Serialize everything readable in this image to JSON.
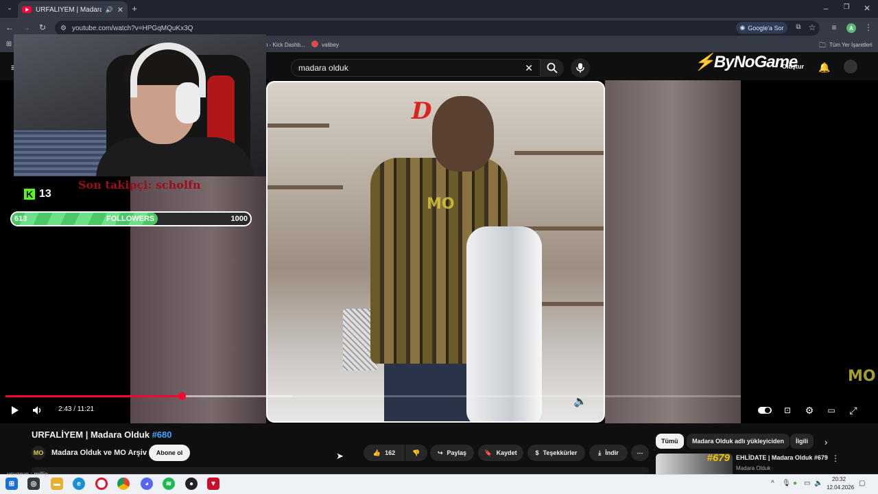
{
  "browser": {
    "tab_title": "URFALİYEM | Madara Olduk",
    "url": "youtube.com/watch?v=HPGqMQuKx3Q",
    "google_sor": "Google'a Sor",
    "bookmarks": [
      {
        "label": "n - Kick Dashb..."
      },
      {
        "label": "valibey"
      }
    ],
    "all_bookmarks": "Tüm Yer İşaretleri",
    "profile_initial": "A"
  },
  "youtube": {
    "search_value": "madara olduk",
    "brand_overlay": "ByNoGame",
    "create_label": "Oluştur"
  },
  "overlay": {
    "last_follower": "Son takipçi: scholfn",
    "kick_count": "13",
    "followers_current": "613",
    "followers_label": "FOLLOWERS",
    "followers_goal": "1000",
    "followers_progress": 0.613,
    "watermark": "MO"
  },
  "player": {
    "time_display": "2:43 / 11:21",
    "played_fraction": 0.24,
    "buffered_fraction": 0.39
  },
  "video": {
    "title": "URFALİYEM | Madara Olduk",
    "title_number": "#680",
    "channel_name": "Madara Olduk ve MO Arşiv",
    "channel_avatar_text": "MO",
    "subscribe_label": "Abone ol",
    "like_count": "162",
    "share_label": "Paylaş",
    "save_label": "Kaydet",
    "thanks_label": "Teşekkürler",
    "download_label": "İndir"
  },
  "sidebar": {
    "chips": [
      {
        "label": "Tümü",
        "active": true
      },
      {
        "label": "Madara Olduk adlı yükleyiciden",
        "active": false
      },
      {
        "label": "İlgili",
        "active": false
      }
    ],
    "rec_badge": "#679",
    "rec_title": "EHLİDATE | Madara Olduk #679",
    "rec_channel": "Madara Olduk"
  },
  "chat": {
    "line": "usvarun : millie"
  },
  "taskbar": {
    "time": "20:32",
    "date": "12.04.2026"
  },
  "colors": {
    "accent_red": "#ff0033",
    "kick_green": "#53fc18",
    "link_blue": "#3ea6ff"
  }
}
